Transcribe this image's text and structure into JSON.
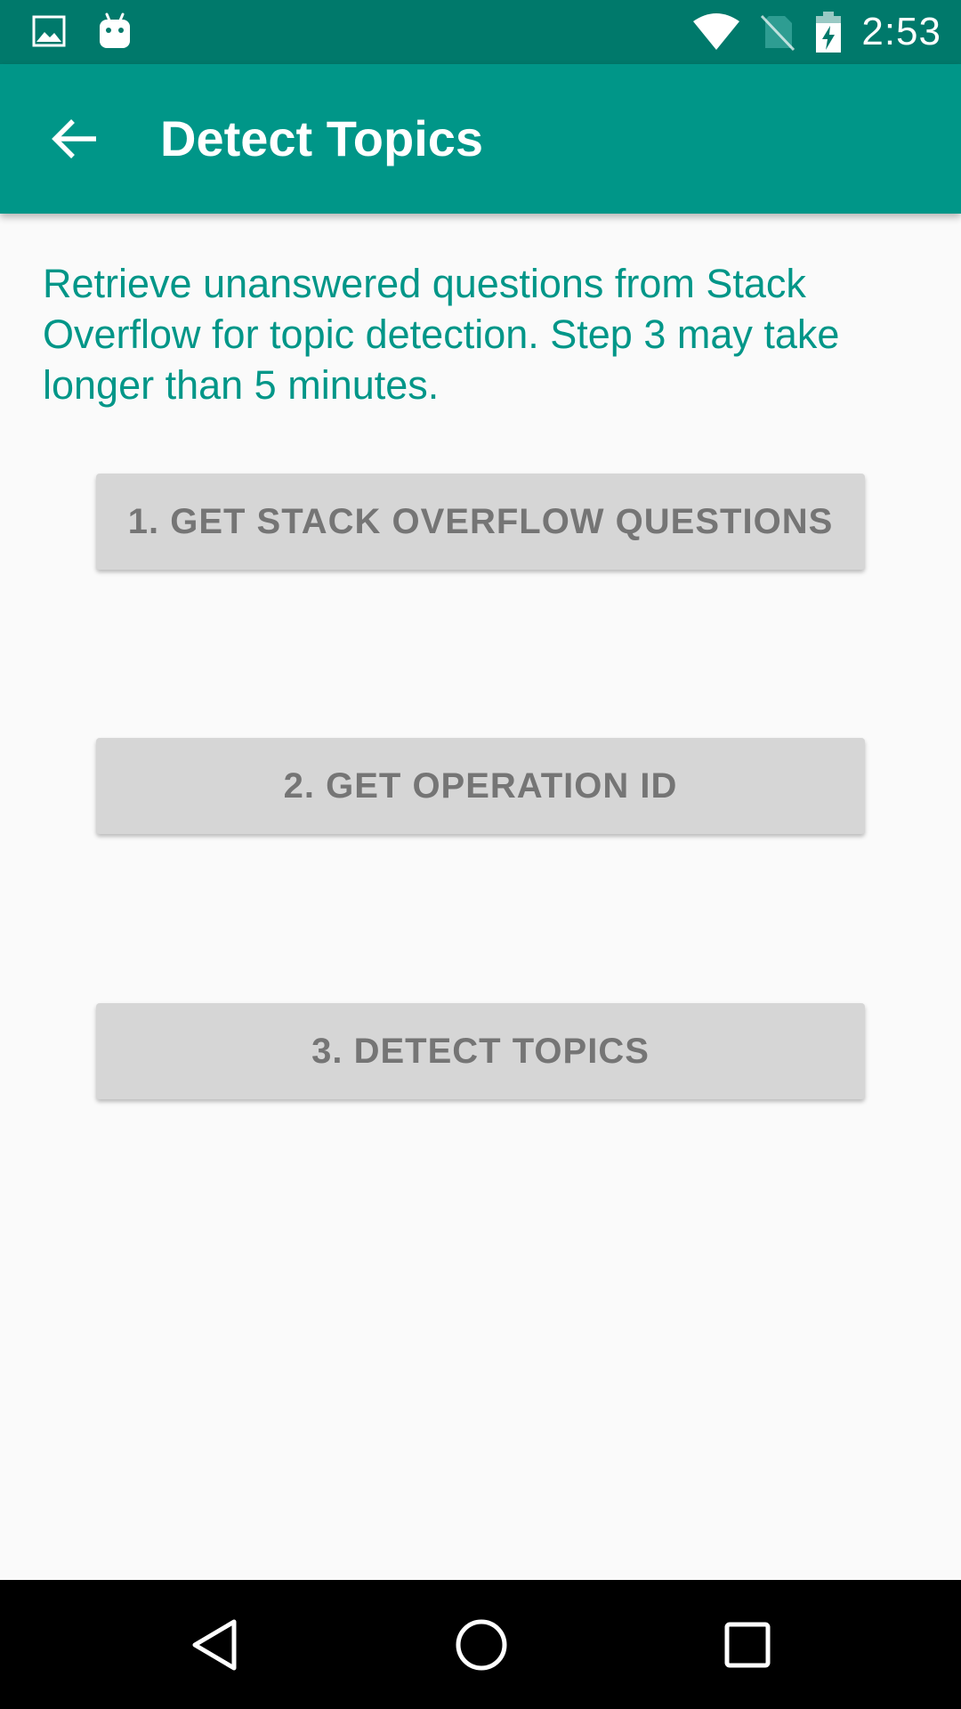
{
  "status_bar": {
    "time": "2:53",
    "left_icons": [
      "image-notification-icon",
      "android-notification-icon"
    ],
    "right_icons": [
      "wifi-icon",
      "no-sim-icon",
      "battery-charging-icon"
    ],
    "color": "#00796b"
  },
  "app_bar": {
    "title": "Detect Topics",
    "back_icon": "arrow-left-icon",
    "color": "#009688"
  },
  "content": {
    "description": "Retrieve unanswered questions from Stack Overflow for topic detection. Step 3 may take longer than 5 minutes.",
    "description_color": "#009688",
    "buttons": [
      {
        "label": "1. GET STACK OVERFLOW QUESTIONS"
      },
      {
        "label": "2. GET OPERATION ID"
      },
      {
        "label": "3. DETECT TOPICS"
      }
    ]
  },
  "nav_bar": {
    "icons": [
      "nav-back-icon",
      "nav-home-icon",
      "nav-recents-icon"
    ]
  }
}
